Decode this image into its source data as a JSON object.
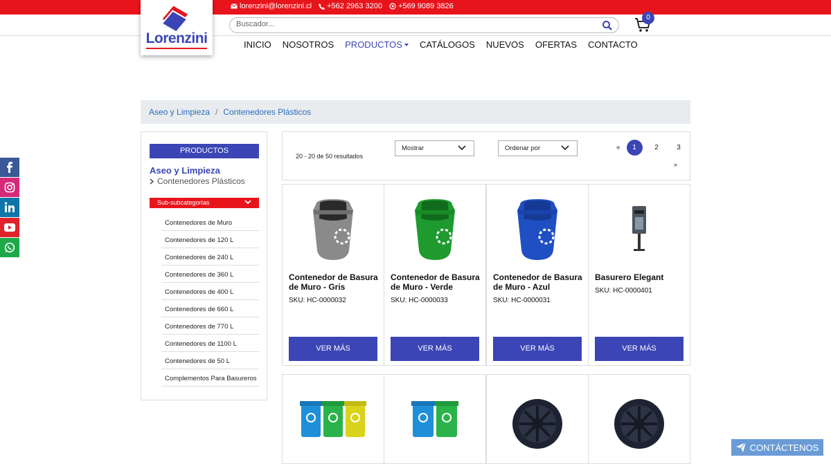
{
  "topbar": {
    "email": "lorenzini@lorenzini.cl",
    "phone": "+562 2963 3200",
    "whatsapp": "+569 9089 3826"
  },
  "logo": {
    "text": "Lorenzini"
  },
  "search": {
    "placeholder": "Buscador..."
  },
  "cart": {
    "count": "0"
  },
  "nav": [
    {
      "label": "INICIO"
    },
    {
      "label": "NOSOTROS"
    },
    {
      "label": "PRODUCTOS"
    },
    {
      "label": "CATÁLOGOS"
    },
    {
      "label": "NUEVOS"
    },
    {
      "label": "OFERTAS"
    },
    {
      "label": "CONTACTO"
    }
  ],
  "breadcrumb": {
    "level1": "Aseo y Limpieza",
    "separator": "/",
    "level2": "Contenedores Plásticos"
  },
  "sidebar": {
    "header": "PRODUCTOS",
    "category": "Aseo y Limpieza",
    "subcategory": "Contenedores Plásticos",
    "dropdown_label": "Sub-subcategorías",
    "items": [
      "Contenedores de Muro",
      "Contenedores de 120 L",
      "Contenedores de 240 L",
      "Contenedores de 360 L",
      "Contenedores de 400 L",
      "Contenedores de 660 L",
      "Contenedores de 770 L",
      "Contenedores de 1100 L",
      "Contenedores de 50 L",
      "Complementos Para Basureros"
    ]
  },
  "toolbar": {
    "results": "20 - 20 de 50 resultados",
    "show_label": "Mostrar",
    "sort_label": "Ordenar por",
    "pager_prev": "«",
    "pages": [
      "1",
      "2",
      "3"
    ],
    "pager_next": "»"
  },
  "products": [
    {
      "name": "Contenedor de Basura de Muro - Gris",
      "sku": "SKU: HC-0000032",
      "button": "VER MÁS",
      "color": "#8a8a8a"
    },
    {
      "name": "Contenedor de Basura de Muro - Verde",
      "sku": "SKU: HC-0000033",
      "button": "VER MÁS",
      "color": "#1e9a2e"
    },
    {
      "name": "Contenedor de Basura de Muro - Azul",
      "sku": "SKU: HC-0000031",
      "button": "VER MÁS",
      "color": "#1f4fc2"
    },
    {
      "name": "Basurero Elegant",
      "sku": "SKU: HC-0000401",
      "button": "VER MÁS",
      "color": "#4a5560"
    }
  ],
  "contact_button": {
    "label": "CONTÁCTENOS"
  },
  "colors": {
    "brand_blue": "#3b45b5",
    "brand_red": "#e8141c"
  }
}
